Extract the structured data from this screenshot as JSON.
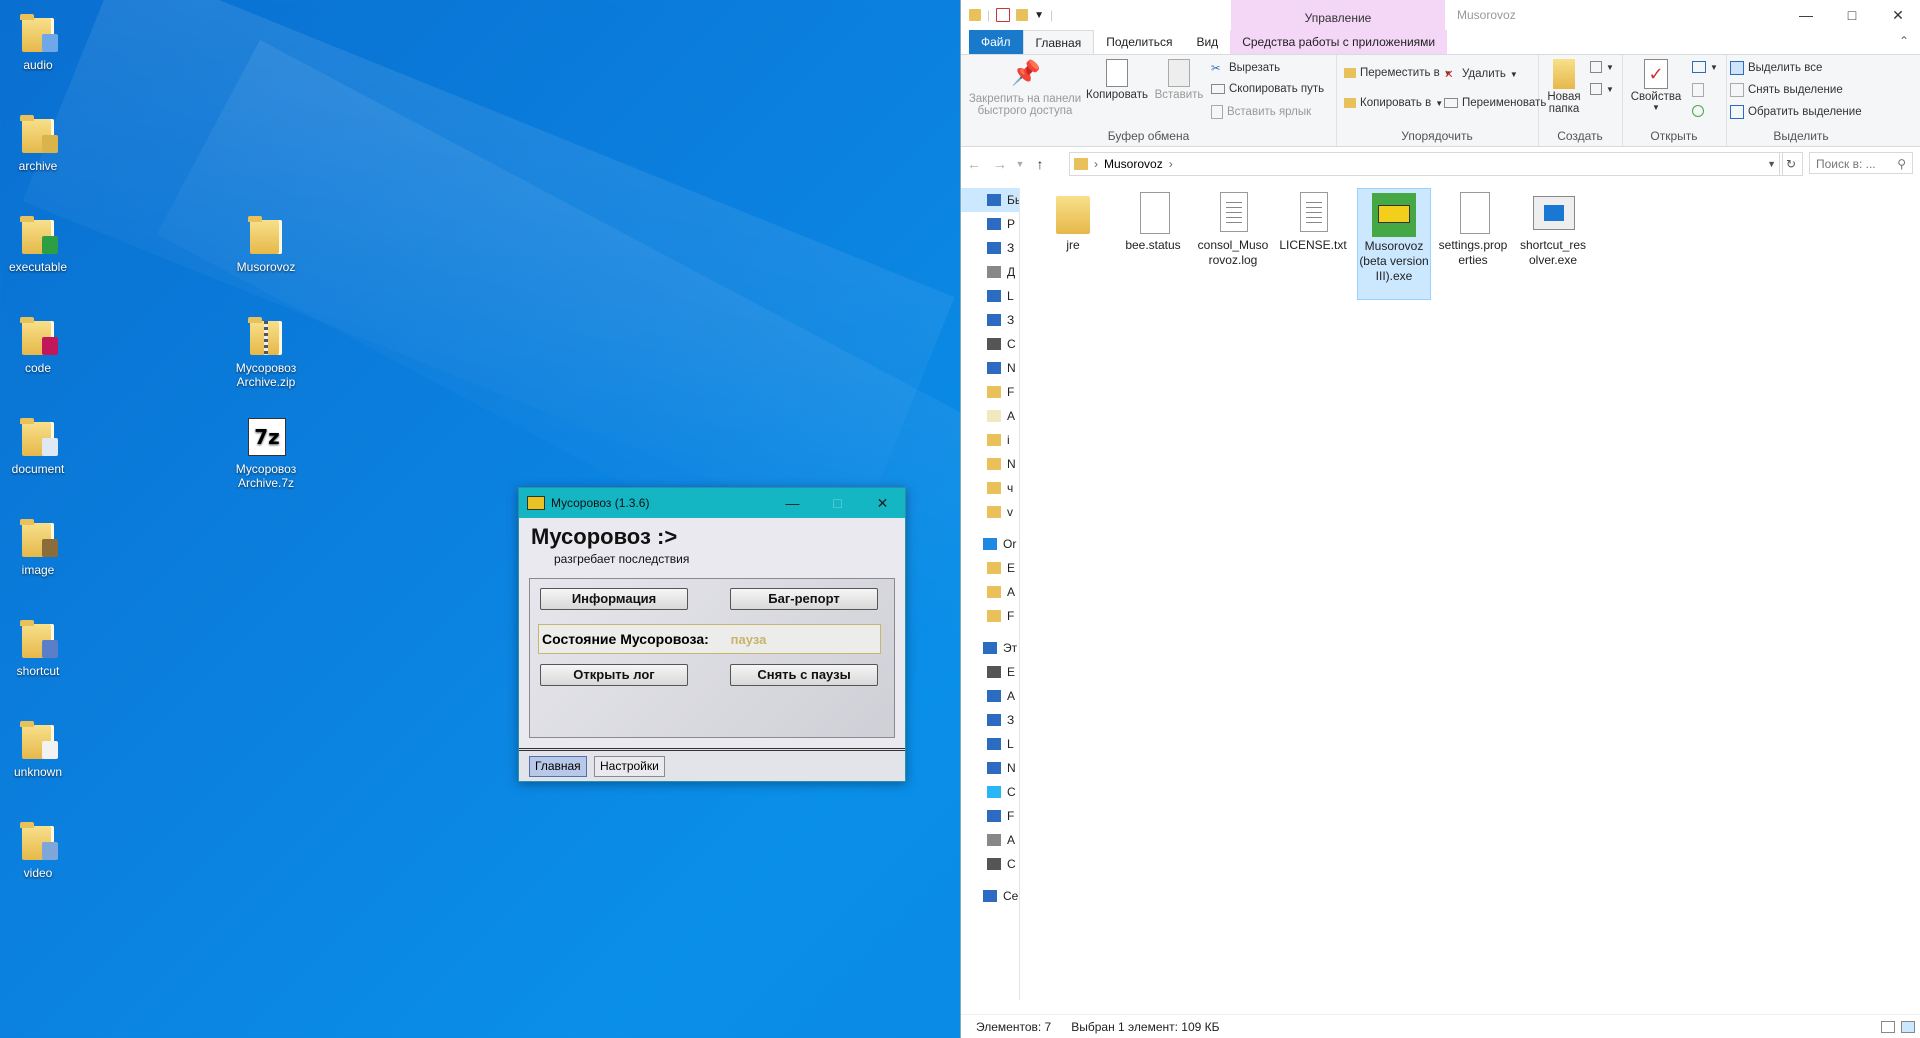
{
  "desktop": {
    "icons_left": [
      {
        "label": "audio",
        "icon": "audio-folder-icon"
      },
      {
        "label": "archive",
        "icon": "archive-folder-icon"
      },
      {
        "label": "executable",
        "icon": "executable-folder-icon"
      },
      {
        "label": "code",
        "icon": "code-folder-icon"
      },
      {
        "label": "document",
        "icon": "document-folder-icon"
      },
      {
        "label": "image",
        "icon": "image-folder-icon"
      },
      {
        "label": "shortcut",
        "icon": "shortcut-folder-icon"
      },
      {
        "label": "unknown",
        "icon": "unknown-folder-icon"
      },
      {
        "label": "video",
        "icon": "video-folder-icon"
      }
    ],
    "icons_right": [
      {
        "label": "Musorovoz",
        "icon": "folder-icon"
      },
      {
        "label": "Мусоровоз Archive.zip",
        "icon": "zip-archive-icon"
      },
      {
        "label": "Мусоровоз Archive.7z",
        "icon": "7zip-archive-icon"
      }
    ]
  },
  "app": {
    "title": "Мусоровоз (1.3.6)",
    "heading": "Мусоровоз :>",
    "subtitle": "разгребает последствия",
    "btn_info": "Информация",
    "btn_bug": "Баг-репорт",
    "status_label": "Состояние Мусоровоза:",
    "status_value": "пауза",
    "btn_open_log": "Открыть лог",
    "btn_unpause": "Снять с паузы",
    "tabs": [
      "Главная",
      "Настройки"
    ]
  },
  "explorer": {
    "context_header": "Управление",
    "window_name": "Musorovoz",
    "ribbon_tabs": [
      "Файл",
      "Главная",
      "Поделиться",
      "Вид",
      "Средства работы с приложениями"
    ],
    "clipboard": {
      "pin": "Закрепить на панели быстрого доступа",
      "copy": "Копировать",
      "paste": "Вставить",
      "cut": "Вырезать",
      "copy_path": "Скопировать путь",
      "paste_shortcut": "Вставить ярлык",
      "group": "Буфер обмена"
    },
    "organize": {
      "move_to": "Переместить в",
      "copy_to": "Копировать в",
      "delete": "Удалить",
      "rename": "Переименовать",
      "group": "Упорядочить"
    },
    "new": {
      "new_folder": "Новая папка",
      "group": "Создать"
    },
    "open": {
      "properties": "Свойства",
      "group": "Открыть"
    },
    "select": {
      "select_all": "Выделить все",
      "select_none": "Снять выделение",
      "invert": "Обратить выделение",
      "group": "Выделить"
    },
    "address": "Musorovoz",
    "search_placeholder": "Поиск в: ...",
    "nav_items": [
      "Бы",
      "Р",
      "З",
      "Д",
      "L",
      "З",
      "С",
      "N",
      "F",
      "A",
      "i",
      "N",
      "ч",
      "v",
      "Or",
      "E",
      "A",
      "F",
      "Эт",
      "E",
      "A",
      "З",
      "L",
      "N",
      "C",
      "F",
      "A",
      "C",
      "Се"
    ],
    "files": [
      {
        "name": "jre",
        "type": "folder"
      },
      {
        "name": "bee.status",
        "type": "file"
      },
      {
        "name": "consol_Musorovoz.log",
        "type": "text"
      },
      {
        "name": "LICENSE.txt",
        "type": "text"
      },
      {
        "name": "Musorovoz (beta version III).exe",
        "type": "exe"
      },
      {
        "name": "settings.properties",
        "type": "file"
      },
      {
        "name": "shortcut_resolver.exe",
        "type": "app"
      }
    ],
    "status_count": "Элементов: 7",
    "status_selected": "Выбран 1 элемент: 109 КБ"
  }
}
